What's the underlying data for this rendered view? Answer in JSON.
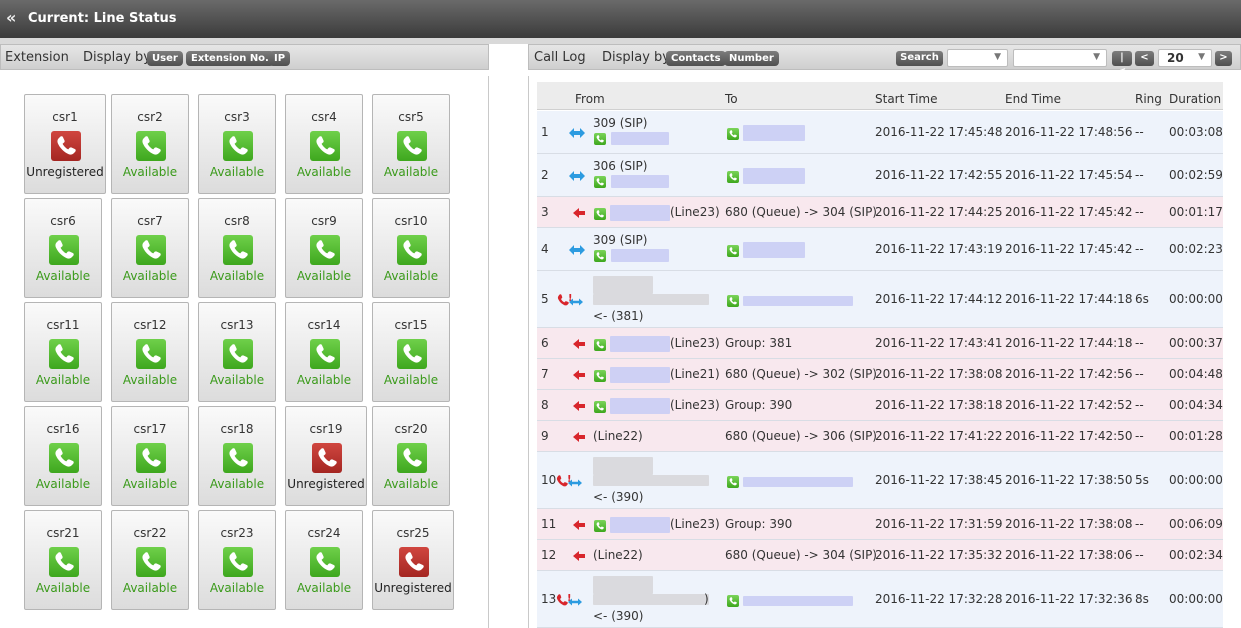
{
  "header": {
    "title": "Current: Line Status"
  },
  "extension_panel": {
    "label": "Extension",
    "display_by_label": "Display by",
    "display_options": [
      "User",
      "Extension No.",
      "IP"
    ],
    "tiles": [
      {
        "name": "csr1",
        "status": "Unregistered",
        "state": "unreg"
      },
      {
        "name": "csr2",
        "status": "Available",
        "state": "avail"
      },
      {
        "name": "csr3",
        "status": "Available",
        "state": "avail"
      },
      {
        "name": "csr4",
        "status": "Available",
        "state": "avail"
      },
      {
        "name": "csr5",
        "status": "Available",
        "state": "avail"
      },
      {
        "name": "csr6",
        "status": "Available",
        "state": "avail"
      },
      {
        "name": "csr7",
        "status": "Available",
        "state": "avail"
      },
      {
        "name": "csr8",
        "status": "Available",
        "state": "avail"
      },
      {
        "name": "csr9",
        "status": "Available",
        "state": "avail"
      },
      {
        "name": "csr10",
        "status": "Available",
        "state": "avail"
      },
      {
        "name": "csr11",
        "status": "Available",
        "state": "avail"
      },
      {
        "name": "csr12",
        "status": "Available",
        "state": "avail"
      },
      {
        "name": "csr13",
        "status": "Available",
        "state": "avail"
      },
      {
        "name": "csr14",
        "status": "Available",
        "state": "avail"
      },
      {
        "name": "csr15",
        "status": "Available",
        "state": "avail"
      },
      {
        "name": "csr16",
        "status": "Available",
        "state": "avail"
      },
      {
        "name": "csr17",
        "status": "Available",
        "state": "avail"
      },
      {
        "name": "csr18",
        "status": "Available",
        "state": "avail"
      },
      {
        "name": "csr19",
        "status": "Unregistered",
        "state": "unreg"
      },
      {
        "name": "csr20",
        "status": "Available",
        "state": "avail"
      },
      {
        "name": "csr21",
        "status": "Available",
        "state": "avail"
      },
      {
        "name": "csr22",
        "status": "Available",
        "state": "avail"
      },
      {
        "name": "csr23",
        "status": "Available",
        "state": "avail"
      },
      {
        "name": "csr24",
        "status": "Available",
        "state": "avail"
      },
      {
        "name": "csr25",
        "status": "Unregistered",
        "state": "unreg"
      }
    ]
  },
  "call_log": {
    "label": "Call Log",
    "display_by_label": "Display by",
    "display_options": [
      "Contacts",
      "Number"
    ],
    "search_label": "Search",
    "page_size": "20",
    "nav": {
      "first": "|<",
      "prev": "<",
      "next": ">"
    },
    "columns": [
      "From",
      "To",
      "Start Time",
      "End Time",
      "Ring",
      "Duration"
    ],
    "rows": [
      {
        "num": "1",
        "kind": "ext",
        "from_a": "309 (SIP)",
        "from_b": "",
        "to": "",
        "start": "2016-11-22 17:45:48",
        "end": "2016-11-22 17:48:56",
        "ring": "--",
        "duration": "00:03:08"
      },
      {
        "num": "2",
        "kind": "ext",
        "from_a": "306 (SIP)",
        "from_b": "",
        "to": "",
        "start": "2016-11-22 17:42:55",
        "end": "2016-11-22 17:45:54",
        "ring": "--",
        "duration": "00:02:59"
      },
      {
        "num": "3",
        "kind": "in",
        "from_a": "(Line23)",
        "from_b": "",
        "to": "680 (Queue) -> 304 (SIP)",
        "start": "2016-11-22 17:44:25",
        "end": "2016-11-22 17:45:42",
        "ring": "--",
        "duration": "00:01:17"
      },
      {
        "num": "4",
        "kind": "ext",
        "from_a": "309 (SIP)",
        "from_b": "",
        "to": "",
        "start": "2016-11-22 17:43:19",
        "end": "2016-11-22 17:45:42",
        "ring": "--",
        "duration": "00:02:23"
      },
      {
        "num": "5",
        "kind": "missed",
        "from_a": "",
        "from_b": "<- (381)",
        "to": "",
        "start": "2016-11-22 17:44:12",
        "end": "2016-11-22 17:44:18",
        "ring": "6s",
        "duration": "00:00:00"
      },
      {
        "num": "6",
        "kind": "in",
        "from_a": "(Line23)",
        "from_b": "",
        "to": "Group: 381",
        "start": "2016-11-22 17:43:41",
        "end": "2016-11-22 17:44:18",
        "ring": "--",
        "duration": "00:00:37"
      },
      {
        "num": "7",
        "kind": "in",
        "from_a": "(Line21)",
        "from_b": "",
        "to": "680 (Queue) -> 302 (SIP)",
        "start": "2016-11-22 17:38:08",
        "end": "2016-11-22 17:42:56",
        "ring": "--",
        "duration": "00:04:48"
      },
      {
        "num": "8",
        "kind": "in",
        "from_a": "(Line23)",
        "from_b": "",
        "to": "Group: 390",
        "start": "2016-11-22 17:38:18",
        "end": "2016-11-22 17:42:52",
        "ring": "--",
        "duration": "00:04:34"
      },
      {
        "num": "9",
        "kind": "in",
        "from_a": "(Line22)",
        "from_b": "",
        "to": "680 (Queue) -> 306 (SIP)",
        "start": "2016-11-22 17:41:22",
        "end": "2016-11-22 17:42:50",
        "ring": "--",
        "duration": "00:01:28"
      },
      {
        "num": "10",
        "kind": "missed",
        "from_a": "",
        "from_b": "<- (390)",
        "to": "",
        "start": "2016-11-22 17:38:45",
        "end": "2016-11-22 17:38:50",
        "ring": "5s",
        "duration": "00:00:00"
      },
      {
        "num": "11",
        "kind": "in",
        "from_a": "(Line23)",
        "from_b": "",
        "to": "Group: 390",
        "start": "2016-11-22 17:31:59",
        "end": "2016-11-22 17:38:08",
        "ring": "--",
        "duration": "00:06:09"
      },
      {
        "num": "12",
        "kind": "in",
        "from_a": "(Line22)",
        "from_b": "",
        "to": "680 (Queue) -> 304 (SIP)",
        "start": "2016-11-22 17:35:32",
        "end": "2016-11-22 17:38:06",
        "ring": "--",
        "duration": "00:02:34"
      },
      {
        "num": "13",
        "kind": "missed",
        "from_a": ")",
        "from_b": "<- (390)",
        "to": "",
        "start": "2016-11-22 17:32:28",
        "end": "2016-11-22 17:32:36",
        "ring": "8s",
        "duration": "00:00:00"
      }
    ]
  },
  "colors": {
    "available": "#3ea71e",
    "unregistered": "#a42622",
    "incoming_row": "#f8e8ee",
    "internal_row": "#eef3fb"
  },
  "icons": {
    "tile_phone": "phone-handset-icon",
    "internal_call": "double-arrow-icon",
    "incoming_call": "red-left-arrow-icon",
    "missed_call": "missed-call-icon"
  }
}
